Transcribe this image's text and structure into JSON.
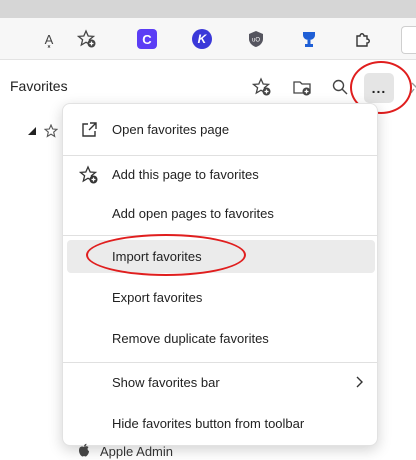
{
  "toolbar": {
    "icons": [
      "read-aloud-icon",
      "add-favorite-icon",
      "c-extension-icon",
      "k-extension-icon",
      "shield-extension-icon",
      "trophy-extension-icon",
      "extensions-puzzle-icon"
    ],
    "read_aloud_glyph": "A͓",
    "c_ext_letter": "C",
    "k_ext_letter": "K"
  },
  "favorites_panel": {
    "title": "Favorites",
    "more_label": "...",
    "tree_root_icon": "star-outline-icon"
  },
  "menu": {
    "items": [
      {
        "label": "Open favorites page",
        "icon": "open-external-icon"
      },
      {
        "label": "Add this page to favorites",
        "icon": "star-add-icon"
      },
      {
        "label": "Add open pages to favorites",
        "icon": ""
      },
      {
        "label": "Import favorites",
        "icon": "",
        "highlighted": true
      },
      {
        "label": "Export favorites",
        "icon": ""
      },
      {
        "label": "Remove duplicate favorites",
        "icon": ""
      },
      {
        "label": "Show favorites bar",
        "icon": "",
        "submenu": true
      },
      {
        "label": "Hide favorites button from toolbar",
        "icon": ""
      }
    ]
  },
  "below_menu": {
    "apple_item_label": "Apple Admin"
  },
  "colors": {
    "annotation_red": "#e01e1e",
    "hover_gray": "#ebebeb",
    "c_ext": "#5b3df5",
    "k_ext": "#3a38d9",
    "trophy_ext": "#1f5fd6"
  }
}
